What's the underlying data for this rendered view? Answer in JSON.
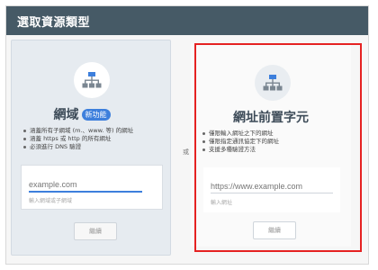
{
  "dialog": {
    "title": "選取資源類型",
    "or_label": "或"
  },
  "domain_card": {
    "icon": "sitemap-icon",
    "title": "網域",
    "badge": "新功能",
    "bullets": [
      "涵蓋所有子網域 (m.、www. 等) 的網址",
      "涵蓋 https 或 http 的所有網址",
      "必須進行 DNS 驗證"
    ],
    "input": {
      "value": "",
      "placeholder": "example.com",
      "helper": "輸入網域或子網域"
    },
    "button": "繼續"
  },
  "url_prefix_card": {
    "icon": "sitemap-icon",
    "title": "網址前置字元",
    "bullets": [
      "僅限輸入網址之下的網址",
      "僅限指定通訊協定下的網址",
      "支援多種驗證方法"
    ],
    "input": {
      "value": "",
      "placeholder": "https://www.example.com",
      "helper": "輸入網址"
    },
    "button": "繼續"
  },
  "colors": {
    "header": "#465a66",
    "accent": "#3d7fdc",
    "highlight": "#e52222"
  }
}
